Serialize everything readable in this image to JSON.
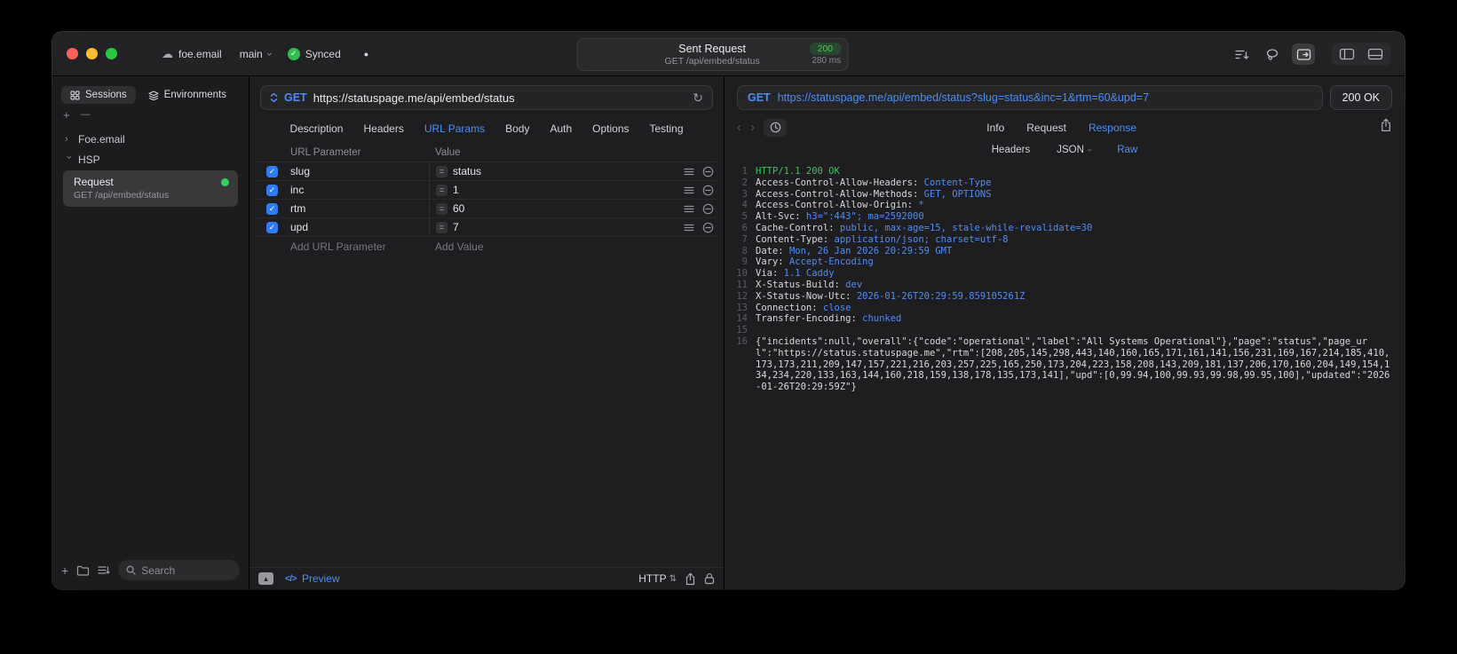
{
  "colors": {
    "accent": "#4d8df6",
    "success": "#32d74b"
  },
  "icons": {
    "cloud": "☁",
    "check": "✓",
    "chevron_right": "›",
    "back": "‹",
    "forward": "›",
    "refresh": "↻",
    "plus": "+",
    "dash": "—",
    "equals": "=",
    "updown": "⇅",
    "collapse": "▴",
    "dot": "●",
    "code_glyph": "</>"
  },
  "titlebar": {
    "project": "foe.email",
    "branch": "main",
    "sync_label": "Synced",
    "center": {
      "title": "Sent Request",
      "status_code": "200",
      "subtitle": "GET /api/embed/status",
      "duration": "280 ms"
    }
  },
  "sidebar": {
    "tabs": [
      {
        "label": "Sessions"
      },
      {
        "label": "Environments"
      }
    ],
    "tree": [
      {
        "label": "Foe.email"
      },
      {
        "label": "HSP"
      }
    ],
    "request_item": {
      "title": "Request",
      "subtitle": "GET /api/embed/status"
    },
    "search_placeholder": "Search"
  },
  "request": {
    "method": "GET",
    "url": "https://statuspage.me/api/embed/status",
    "tabs": [
      "Description",
      "Headers",
      "URL Params",
      "Body",
      "Auth",
      "Options",
      "Testing"
    ],
    "active_tab": "URL Params",
    "table": {
      "headers": [
        "URL Parameter",
        "Value"
      ],
      "rows": [
        {
          "name": "slug",
          "value": "status",
          "checked": true
        },
        {
          "name": "inc",
          "value": "1",
          "checked": true
        },
        {
          "name": "rtm",
          "value": "60",
          "checked": true
        },
        {
          "name": "upd",
          "value": "7",
          "checked": true
        }
      ],
      "add_name_placeholder": "Add URL Parameter",
      "add_value_placeholder": "Add Value"
    },
    "footer": {
      "preview_label": "Preview",
      "protocol": "HTTP"
    }
  },
  "response": {
    "method": "GET",
    "url": "https://statuspage.me/api/embed/status?slug=status&inc=1&rtm=60&upd=7",
    "status": "200 OK",
    "tabs": [
      "Info",
      "Request",
      "Response"
    ],
    "active_tab": "Response",
    "subtabs": [
      "Headers",
      "JSON",
      "Raw"
    ],
    "active_subtab": "Raw",
    "status_line": "HTTP/1.1 200 OK",
    "headers": [
      {
        "name": "Access-Control-Allow-Headers",
        "value": "Content-Type"
      },
      {
        "name": "Access-Control-Allow-Methods",
        "value": "GET, OPTIONS"
      },
      {
        "name": "Access-Control-Allow-Origin",
        "value": "*"
      },
      {
        "name": "Alt-Svc",
        "value": "h3=\":443\"; ma=2592000"
      },
      {
        "name": "Cache-Control",
        "value": "public, max-age=15, stale-while-revalidate=30"
      },
      {
        "name": "Content-Type",
        "value": "application/json; charset=utf-8"
      },
      {
        "name": "Date",
        "value": "Mon, 26 Jan 2026 20:29:59 GMT"
      },
      {
        "name": "Vary",
        "value": "Accept-Encoding"
      },
      {
        "name": "Via",
        "value": "1.1 Caddy"
      },
      {
        "name": "X-Status-Build",
        "value": "dev"
      },
      {
        "name": "X-Status-Now-Utc",
        "value": "2026-01-26T20:29:59.859105261Z"
      },
      {
        "name": "Connection",
        "value": "close"
      },
      {
        "name": "Transfer-Encoding",
        "value": "chunked"
      }
    ],
    "body": "{\"incidents\":null,\"overall\":{\"code\":\"operational\",\"label\":\"All Systems Operational\"},\"page\":\"status\",\"page_url\":\"https://status.statuspage.me\",\"rtm\":[208,205,145,298,443,140,160,165,171,161,141,156,231,169,167,214,185,410,173,173,211,209,147,157,221,216,203,257,225,165,250,173,204,223,158,208,143,209,181,137,206,170,160,204,149,154,134,234,220,133,163,144,160,218,159,138,178,135,173,141],\"upd\":[0,99.94,100,99.93,99.98,99.95,100],\"updated\":\"2026-01-26T20:29:59Z\"}"
  }
}
